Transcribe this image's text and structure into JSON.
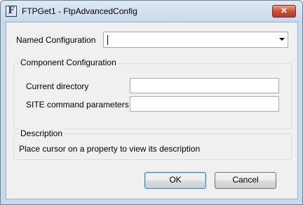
{
  "window": {
    "title": "FTPGet1 - FtpAdvancedConfig",
    "app_icon_glyph": "F",
    "close_glyph": "✕"
  },
  "named_configuration": {
    "label": "Named Configuration",
    "value": ""
  },
  "component_configuration": {
    "group_label": "Component Configuration",
    "fields": [
      {
        "label": "Current directory",
        "value": ""
      },
      {
        "label": "SITE command parameters",
        "value": ""
      }
    ]
  },
  "description": {
    "group_label": "Description",
    "text": "Place cursor on a property to view its description"
  },
  "buttons": {
    "ok": "OK",
    "cancel": "Cancel"
  }
}
